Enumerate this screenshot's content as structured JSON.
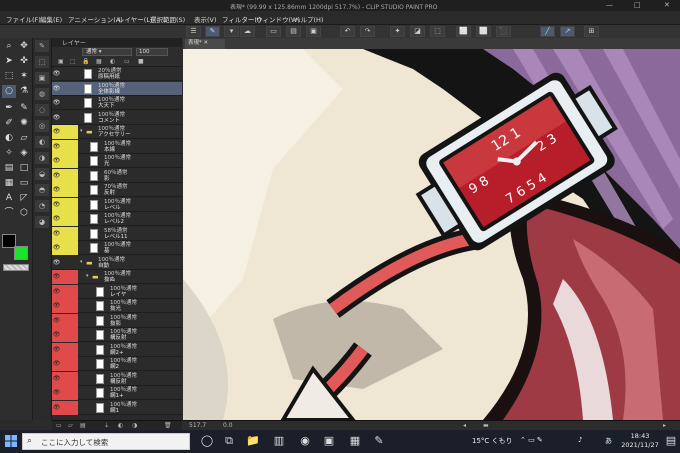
{
  "window": {
    "title": "表現* (99.99 x 125.86mm 1200dpi 517.7%) - CLIP STUDIO PAINT PRO",
    "min": "—",
    "max": "□",
    "close": "✕"
  },
  "menu": [
    "ファイル(F)",
    "編集(E)",
    "アニメーション(A)",
    "レイヤー(L)",
    "選択範囲(S)",
    "表示(V)",
    "フィルター(I)",
    "ウィンドウ(W)",
    "ヘルプ(H)"
  ],
  "layer_panel": {
    "title": "レイヤー",
    "blend_mode": "通常",
    "opacity": "100",
    "rows": [
      {
        "mode": "20％通常",
        "name": "原稿用紙",
        "thumb": "#fff",
        "sel": false,
        "color": "",
        "level": 0,
        "kind": "layer"
      },
      {
        "mode": "100％通常",
        "name": "全体影線",
        "thumb": "#fff",
        "sel": true,
        "color": "",
        "level": 0,
        "kind": "layer"
      },
      {
        "mode": "100％通常",
        "name": "大天下",
        "thumb": "#fff",
        "sel": false,
        "color": "",
        "level": 0,
        "kind": "layer"
      },
      {
        "mode": "100％通常",
        "name": "コメント",
        "thumb": "#fff",
        "sel": false,
        "color": "",
        "level": 0,
        "kind": "layer"
      },
      {
        "mode": "100％通常",
        "name": "アクセサリー",
        "thumb": "",
        "sel": false,
        "color": "#e8e04a",
        "level": 0,
        "kind": "folder"
      },
      {
        "mode": "100％通常",
        "name": "本線",
        "thumb": "#fff",
        "sel": false,
        "color": "#e8e04a",
        "level": 1,
        "kind": "layer"
      },
      {
        "mode": "100％通常",
        "name": "光",
        "thumb": "#fff",
        "sel": false,
        "color": "#e8e04a",
        "level": 1,
        "kind": "layer"
      },
      {
        "mode": "60％通常",
        "name": "影",
        "thumb": "#fff",
        "sel": false,
        "color": "#e8e04a",
        "level": 1,
        "kind": "layer"
      },
      {
        "mode": "70％通常",
        "name": "反射",
        "thumb": "#fff",
        "sel": false,
        "color": "#e8e04a",
        "level": 1,
        "kind": "layer"
      },
      {
        "mode": "100％通常",
        "name": "レベル",
        "thumb": "#fff",
        "sel": false,
        "color": "#e8e04a",
        "level": 1,
        "kind": "layer"
      },
      {
        "mode": "100％通常",
        "name": "レベル2",
        "thumb": "#fff",
        "sel": false,
        "color": "#e8e04a",
        "level": 1,
        "kind": "layer"
      },
      {
        "mode": "58％通常",
        "name": "レベル11",
        "thumb": "#fff",
        "sel": false,
        "color": "#e8e04a",
        "level": 1,
        "kind": "layer"
      },
      {
        "mode": "100％通常",
        "name": "基",
        "thumb": "#fff",
        "sel": false,
        "color": "#e8e04a",
        "level": 1,
        "kind": "layer"
      },
      {
        "mode": "100％通常",
        "name": "自動",
        "thumb": "",
        "sel": false,
        "color": "",
        "level": 0,
        "kind": "folder"
      },
      {
        "mode": "100％通常",
        "name": "抜ぬ",
        "thumb": "",
        "sel": false,
        "color": "#e04a4a",
        "level": 1,
        "kind": "folder"
      },
      {
        "mode": "100％通常",
        "name": "レイヤ",
        "thumb": "#fff",
        "sel": false,
        "color": "#e04a4a",
        "level": 2,
        "kind": "layer"
      },
      {
        "mode": "100％通常",
        "name": "抜光",
        "thumb": "#fff",
        "sel": false,
        "color": "#e04a4a",
        "level": 2,
        "kind": "layer"
      },
      {
        "mode": "100％通常",
        "name": "抜影",
        "thumb": "#fff",
        "sel": false,
        "color": "#e04a4a",
        "level": 2,
        "kind": "layer"
      },
      {
        "mode": "100％通常",
        "name": "構反射",
        "thumb": "#fff",
        "sel": false,
        "color": "#e04a4a",
        "level": 2,
        "kind": "layer"
      },
      {
        "mode": "100％通常",
        "name": "網2+",
        "thumb": "#fff",
        "sel": false,
        "color": "#e04a4a",
        "level": 2,
        "kind": "layer"
      },
      {
        "mode": "100％通常",
        "name": "網2",
        "thumb": "#fff",
        "sel": false,
        "color": "#e04a4a",
        "level": 2,
        "kind": "layer"
      },
      {
        "mode": "100％通常",
        "name": "構反射",
        "thumb": "#fff",
        "sel": false,
        "color": "#e04a4a",
        "level": 2,
        "kind": "layer"
      },
      {
        "mode": "100％通常",
        "name": "網1+",
        "thumb": "#fff",
        "sel": false,
        "color": "#e04a4a",
        "level": 2,
        "kind": "layer"
      },
      {
        "mode": "100％通常",
        "name": "網1",
        "thumb": "#fff",
        "sel": false,
        "color": "#e04a4a",
        "level": 2,
        "kind": "layer"
      }
    ]
  },
  "canvas": {
    "tab": "表現*"
  },
  "navigator": {
    "zoom": "517.7",
    "angle": "0.0"
  },
  "taskbar": {
    "search_placeholder": "ここに入力して検索",
    "weather": "15°C くもり",
    "ime": "あ",
    "time": "18:43",
    "date": "2021/11/27"
  }
}
